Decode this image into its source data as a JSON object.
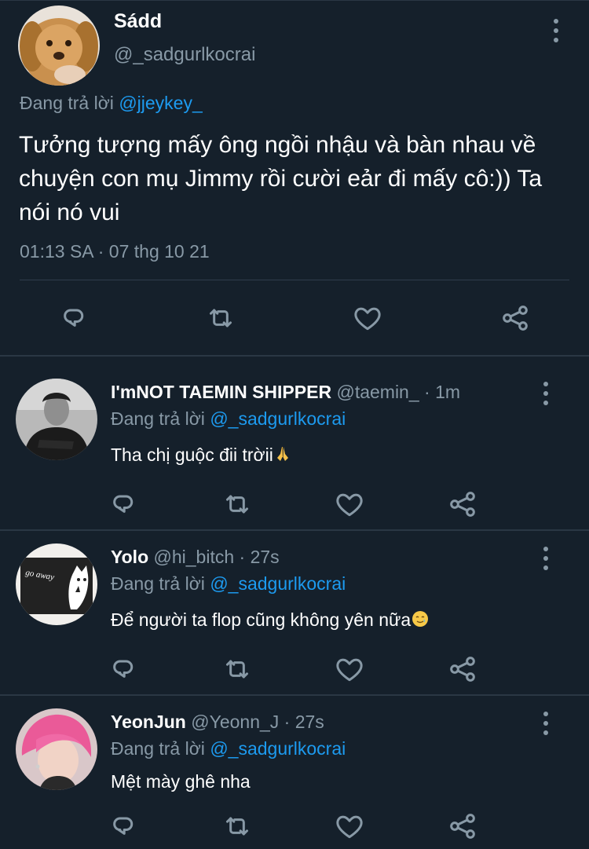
{
  "main_tweet": {
    "display_name": "Sádd",
    "handle": "@_sadgurlkocrai",
    "reply_prefix": "Đang trả lời",
    "reply_to": "@jjeykey_",
    "text": "Tưởng tượng mấy ông ngồi nhậu và bàn nhau về chuyện con mụ Jimmy rồi cười eảr đi mấy cô:)) Ta nói nó vui",
    "timestamp": "01:13 SA · 07 thg 10 21"
  },
  "replies": [
    {
      "display_name": "I'mNOT TAEMIN SHIPPER",
      "meta": "@taemin_ · 1m",
      "reply_prefix": "Đang trả lời",
      "reply_to": "@_sadgurlkocrai",
      "text": "Tha chị guộc đii trờii",
      "emoji": "🙏"
    },
    {
      "display_name": "Yolo",
      "meta": "@hi_bitch · 27s",
      "reply_prefix": "Đang trả lời",
      "reply_to": "@_sadgurlkocrai",
      "text": "Để người ta flop cũng không yên nữa",
      "emoji": "🥲",
      "avatar_text": "go away"
    },
    {
      "display_name": "YeonJun",
      "meta": "@Yeonn_J · 27s",
      "reply_prefix": "Đang trả lời",
      "reply_to": "@_sadgurlkocrai",
      "text": "Mệt mày ghê nha"
    }
  ],
  "icons": {
    "reply": "reply-icon",
    "retweet": "retweet-icon",
    "like": "heart-icon",
    "share": "share-icon",
    "more": "more-icon"
  },
  "colors": {
    "background": "#15202b",
    "mention": "#1d9bf0",
    "secondary_text": "#8899a6",
    "divider": "#2f3d4c"
  }
}
